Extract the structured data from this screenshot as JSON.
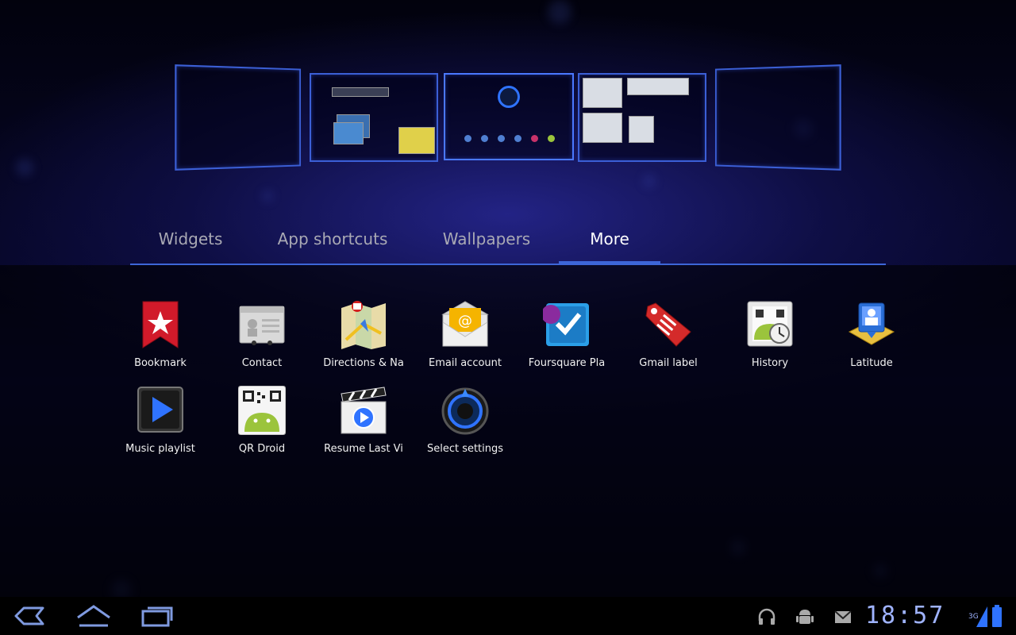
{
  "tabs": [
    {
      "label": "Widgets",
      "active": false
    },
    {
      "label": "App shortcuts",
      "active": false
    },
    {
      "label": "Wallpapers",
      "active": false
    },
    {
      "label": "More",
      "active": true
    }
  ],
  "items": [
    {
      "label": "Bookmark",
      "icon": "bookmark-icon"
    },
    {
      "label": "Contact",
      "icon": "contact-icon"
    },
    {
      "label": "Directions & Na",
      "icon": "directions-icon"
    },
    {
      "label": "Email account",
      "icon": "email-icon"
    },
    {
      "label": "Foursquare Pla",
      "icon": "foursquare-icon"
    },
    {
      "label": "Gmail label",
      "icon": "gmail-label-icon"
    },
    {
      "label": "History",
      "icon": "history-icon"
    },
    {
      "label": "Latitude",
      "icon": "latitude-icon"
    },
    {
      "label": "Music playlist",
      "icon": "music-playlist-icon"
    },
    {
      "label": "QR Droid",
      "icon": "qr-droid-icon"
    },
    {
      "label": "Resume Last Vi",
      "icon": "resume-video-icon"
    },
    {
      "label": "Select settings",
      "icon": "settings-icon"
    }
  ],
  "statusbar": {
    "time": "18:57",
    "network": "3G"
  },
  "colors": {
    "accent": "#3d66d8",
    "clock": "#9fb3ff"
  }
}
